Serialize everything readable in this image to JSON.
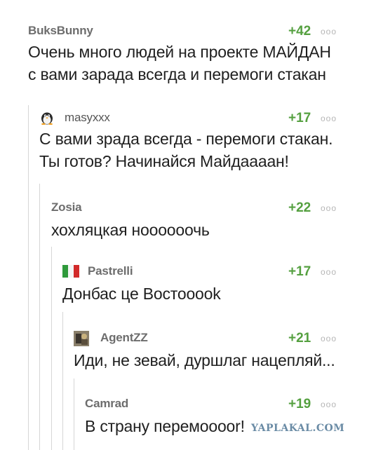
{
  "comments": [
    {
      "author": "BuksBunny",
      "rating": "+42",
      "menu": "ooo",
      "lines": [
        "Очень много людей на проекте МАЙДАН",
        "с вами зарада всегда и перемоги стакан"
      ],
      "avatar": "none"
    },
    {
      "author": "masyxxx",
      "rating": "+17",
      "menu": "ooo",
      "lines": [
        "С вами зрада всегда - перемоги стакан.",
        "Ты готов? Начинайся Майдаааан!"
      ],
      "avatar": "penguin-icon"
    },
    {
      "author": "Zosia",
      "rating": "+22",
      "menu": "ooo",
      "lines": [
        "хохляцкая ноооооочь"
      ],
      "avatar": "none"
    },
    {
      "author": "Pastrelli",
      "rating": "+17",
      "menu": "ooo",
      "lines": [
        "Донбас це Востооook"
      ],
      "avatar": "italy-flag-icon"
    },
    {
      "author": "AgentZZ",
      "rating": "+21",
      "menu": "ooo",
      "lines": [
        "Иди, не зевай, дуршлаг нацепляй..."
      ],
      "avatar": "photo-avatar"
    },
    {
      "author": "Camrad",
      "rating": "+19",
      "menu": "ooo",
      "lines": [
        "В страну перемооoor!"
      ],
      "avatar": "none"
    }
  ],
  "watermark": "YAPLAKAL.COM",
  "colors": {
    "rating": "#55a040",
    "author": "#6d6d6d",
    "thread_line": "#d6d6d6",
    "watermark": "#6a8ba5"
  }
}
